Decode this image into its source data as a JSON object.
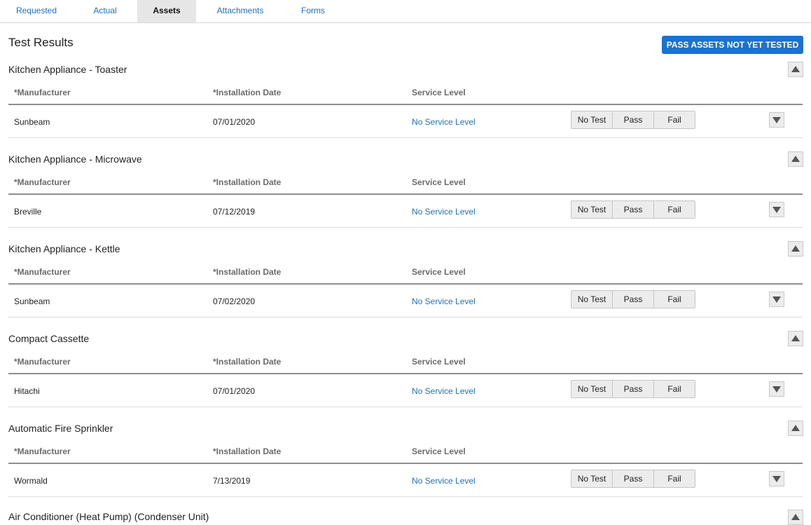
{
  "tabs": [
    {
      "label": "Requested",
      "active": false
    },
    {
      "label": "Actual",
      "active": false
    },
    {
      "label": "Assets",
      "active": true
    },
    {
      "label": "Attachments",
      "active": false
    },
    {
      "label": "Forms",
      "active": false
    }
  ],
  "page": {
    "title": "Test Results",
    "pass_button_label": "PASS ASSETS NOT YET TESTED"
  },
  "columns": {
    "manufacturer": "*Manufacturer",
    "installation_date": "*Installation Date",
    "service_level": "Service Level"
  },
  "test_buttons": {
    "no_test": "No Test",
    "pass": "Pass",
    "fail": "Fail"
  },
  "assets": [
    {
      "name": "Kitchen Appliance - Toaster",
      "manufacturer": "Sunbeam",
      "installation_date": "07/01/2020",
      "service_level": "No Service Level"
    },
    {
      "name": "Kitchen Appliance - Microwave",
      "manufacturer": "Breville",
      "installation_date": "07/12/2019",
      "service_level": "No Service Level"
    },
    {
      "name": "Kitchen Appliance - Kettle",
      "manufacturer": "Sunbeam",
      "installation_date": "07/02/2020",
      "service_level": "No Service Level"
    },
    {
      "name": "Compact Cassette",
      "manufacturer": "Hitachi",
      "installation_date": "07/01/2020",
      "service_level": "No Service Level"
    },
    {
      "name": "Automatic Fire Sprinkler",
      "manufacturer": "Wormald",
      "installation_date": "7/13/2019",
      "service_level": "No Service Level"
    },
    {
      "name": "Air Conditioner (Heat Pump) (Condenser Unit)"
    }
  ],
  "colors": {
    "accent": "#1b72d0",
    "link": "#1f6fbf",
    "active_tab_bg": "#e6e6e6",
    "button_bg": "#ececec"
  },
  "icons": {
    "collapse": "triangle-up-icon",
    "expand": "triangle-down-icon"
  }
}
